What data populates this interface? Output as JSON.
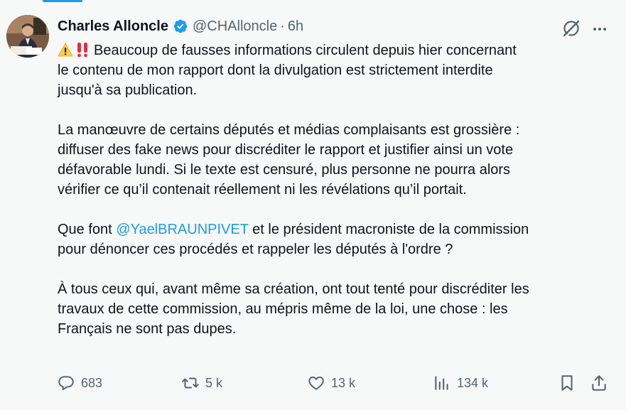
{
  "tweet": {
    "author_name": "Charles Alloncle",
    "handle": "@CHAlloncle",
    "separator": "·",
    "time": "6h",
    "icons": {
      "verified": "verified-badge-icon",
      "grok": "grok-icon",
      "more": "more-icon"
    },
    "paragraphs": [
      {
        "lines": [
          "Beaucoup de fausses informations circulent depuis hier concernant",
          "le contenu de mon rapport dont la divulgation est strictement interdite",
          "jusqu'à sa publication."
        ]
      },
      {
        "lines": [
          "La manœuvre de certains députés et médias complaisants est grossière :",
          "diffuser des fake news pour discréditer le rapport et justifier ainsi un vote",
          "défavorable lundi. Si le texte est censuré, plus personne ne pourra alors",
          "vérifier ce qu’il contenait réellement ni les révélations qu’il portait."
        ]
      },
      {
        "line1_prefix": "Que font ",
        "mention": "@YaelBRAUNPIVET",
        "line1_suffix": " et le président macroniste de la commission",
        "line2": "pour dénoncer ces procédés et rappeler les députés à l'ordre ?"
      },
      {
        "lines": [
          "À tous ceux qui, avant même sa création, ont tout tenté pour discréditer les",
          "travaux de cette commission, au mépris même de la loi, une chose : les",
          "Français ne sont pas dupes."
        ]
      }
    ],
    "actions": {
      "replies": "683",
      "reposts": "5 k",
      "likes": "13 k",
      "views": "134 k"
    },
    "colors": {
      "accent": "#1d9bf0",
      "muted": "#536471",
      "text": "#0f1419",
      "background": "#f7f9f9"
    }
  }
}
